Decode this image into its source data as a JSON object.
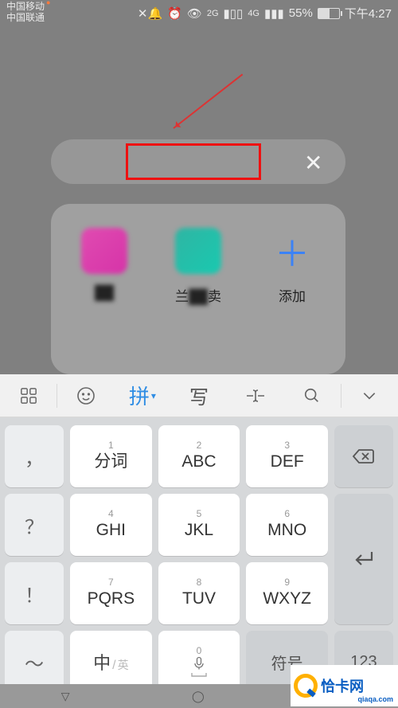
{
  "status": {
    "carrier1": "中国移动",
    "carrier2": "中国联通",
    "net1": "2G",
    "net2": "4G",
    "battery_pct": "55%",
    "time": "下午4:27"
  },
  "search": {
    "close": "✕"
  },
  "apps": {
    "a1_label": "██",
    "a2_label_prefix": "兰",
    "a2_label_mid": "██",
    "a2_label_suffix": "卖",
    "add_label": "添加",
    "add_glyph": "＋"
  },
  "toolbar": {
    "pinyin": "拼",
    "write": "写"
  },
  "keys": {
    "side": {
      "comma": "，",
      "q": "？",
      "bang": "！",
      "tilde": "～"
    },
    "d1": "1",
    "m1": "分词",
    "d2": "2",
    "m2": "ABC",
    "d3": "3",
    "m3": "DEF",
    "d4": "4",
    "m4": "GHI",
    "d5": "5",
    "m5": "JKL",
    "d6": "6",
    "m6": "MNO",
    "d7": "7",
    "m7": "PQRS",
    "d8": "8",
    "m8": "TUV",
    "d9": "9",
    "m9": "WXYZ",
    "d0": "0",
    "lang_big": "中",
    "lang_slash": "/",
    "lang_sm": "英",
    "sym": "符号",
    "num": "123"
  },
  "watermark": {
    "name": "恰卡网",
    "url": "qiaqa.com"
  }
}
